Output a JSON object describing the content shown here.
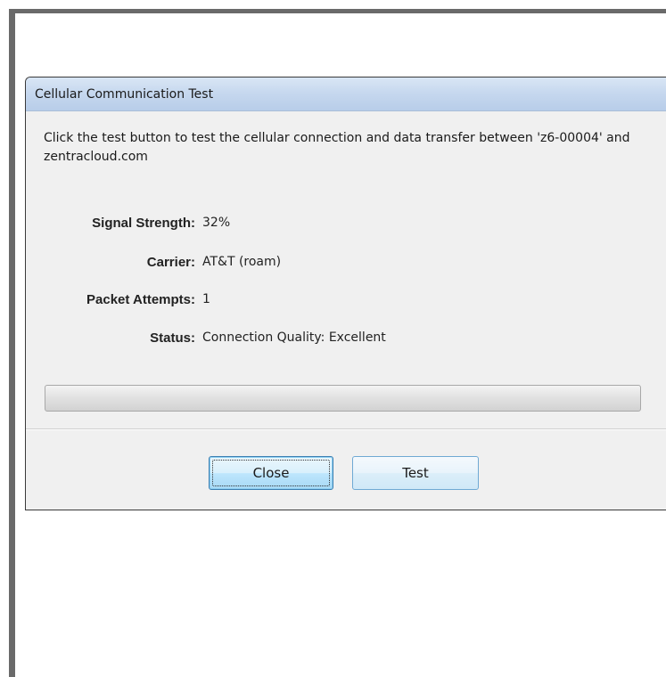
{
  "dialog": {
    "title": "Cellular Communication Test",
    "intro_text": "Click the test button to test the cellular connection and data transfer between 'z6-00004' and zentracloud.com"
  },
  "fields": {
    "signal_strength": {
      "label": "Signal Strength:",
      "value": "32%"
    },
    "carrier": {
      "label": "Carrier:",
      "value": "AT&T (roam)"
    },
    "packet_attempts": {
      "label": "Packet Attempts:",
      "value": "1"
    },
    "status": {
      "label": "Status:",
      "value": "Connection Quality: Excellent"
    }
  },
  "progress": {
    "value": 0
  },
  "buttons": {
    "close_label": "Close",
    "test_label": "Test"
  },
  "colors": {
    "title_bar": "#c5d7ee",
    "dialog_background": "#f0f0f0",
    "focused_button_border": "#3c7fb1",
    "frame_border": "#6a6a6a"
  }
}
